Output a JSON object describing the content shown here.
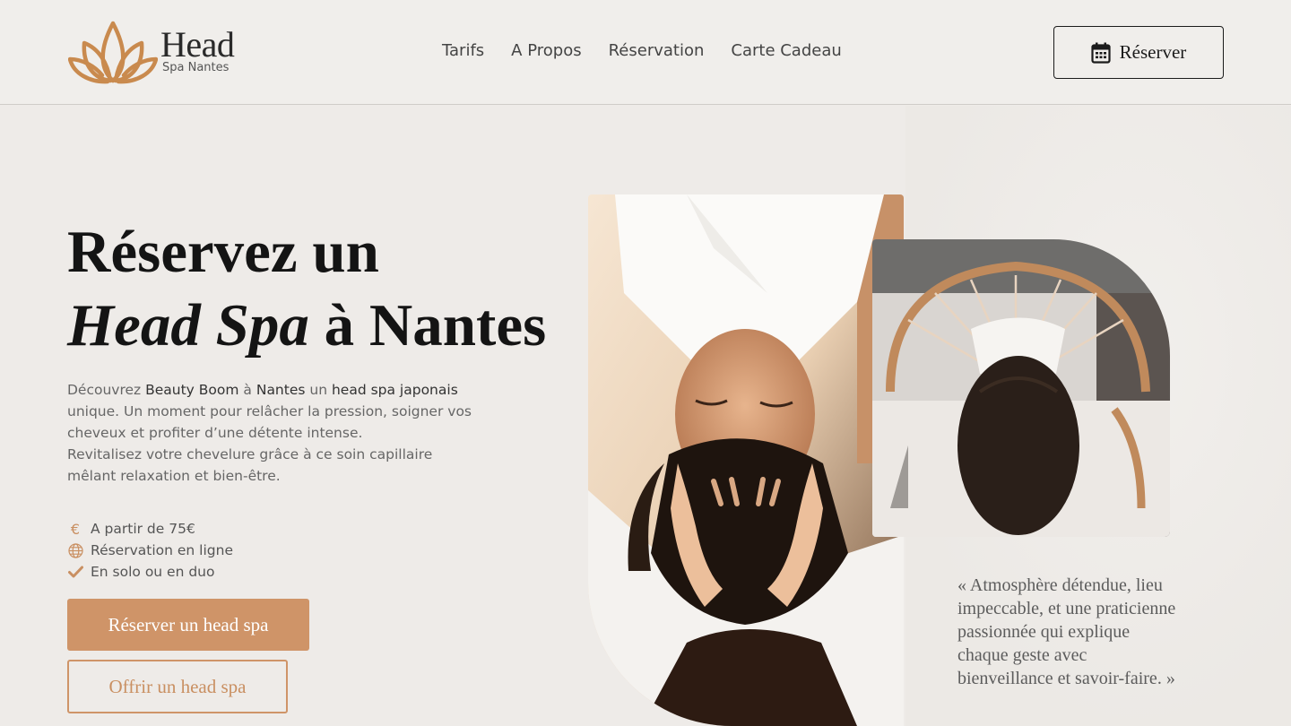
{
  "brand": {
    "name": "Head",
    "subtitle": "Spa Nantes",
    "accent": "#cf9468",
    "text_dark": "#141414",
    "background": "#eeebe8"
  },
  "nav": {
    "items": [
      {
        "label": "Tarifs"
      },
      {
        "label": "A Propos"
      },
      {
        "label": "Réservation"
      },
      {
        "label": "Carte Cadeau"
      }
    ]
  },
  "header_cta": {
    "label": "Réserver",
    "icon": "calendar-icon"
  },
  "hero": {
    "title_line1": "Réservez un",
    "title_italic": "Head Spa",
    "title_rest": " à Nantes",
    "intro": {
      "p1_pre": "Découvrez ",
      "p1_brand": "Beauty Boom",
      "p1_mid": " à ",
      "p1_city": "Nantes",
      "p1_mid2": " un ",
      "p1_kw": "head spa japonais",
      "p1_post": " unique. Un moment pour relâcher la pression, soigner vos cheveux et profiter d’une détente intense.",
      "p2": "Revitalisez votre chevelure grâce à ce soin capillaire mêlant relaxation et bien-être."
    },
    "features": [
      {
        "icon": "euro-icon",
        "label": "A partir de 75€"
      },
      {
        "icon": "globe-icon",
        "label": "Réservation en ligne"
      },
      {
        "icon": "check-icon",
        "label": "En solo ou en duo"
      }
    ],
    "primary_button": "Réserver un head spa",
    "secondary_button": "Offrir un head spa"
  },
  "testimonial": {
    "text": "« Atmosphère détendue, lieu impeccable, et une praticienne passionnée qui explique chaque geste avec bienveillance et savoir-faire. »"
  }
}
